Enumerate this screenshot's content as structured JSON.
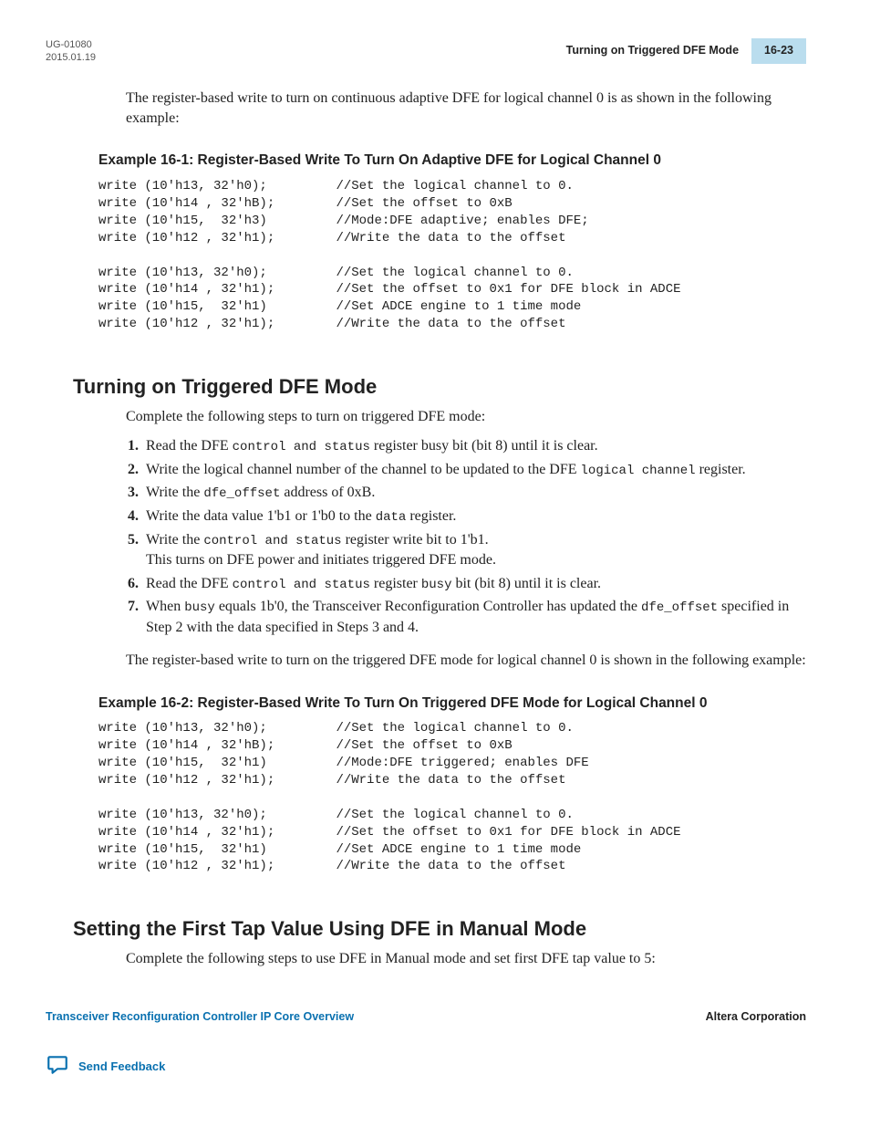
{
  "header": {
    "doc_id": "UG-01080",
    "date": "2015.01.19",
    "running_title": "Turning on Triggered DFE Mode",
    "page_num": "16-23"
  },
  "intro_para": "The register-based write to turn on continuous adaptive DFE for logical channel 0 is as shown in the following example:",
  "example1": {
    "title": "Example 16-1: Register-Based Write To Turn On Adaptive DFE for Logical Channel 0",
    "code": "write (10'h13, 32'h0);         //Set the logical channel to 0.\nwrite (10'h14 , 32'hB);        //Set the offset to 0xB\nwrite (10'h15,  32'h3)         //Mode:DFE adaptive; enables DFE;\nwrite (10'h12 , 32'h1);        //Write the data to the offset\n\nwrite (10'h13, 32'h0);         //Set the logical channel to 0.\nwrite (10'h14 , 32'h1);        //Set the offset to 0x1 for DFE block in ADCE\nwrite (10'h15,  32'h1)         //Set ADCE engine to 1 time mode\nwrite (10'h12 , 32'h1);        //Write the data to the offset"
  },
  "section1": {
    "heading": "Turning on Triggered DFE Mode",
    "intro": "Complete the following steps to turn on triggered DFE mode:",
    "steps": [
      "Read the DFE <span class=\"mono\">control and status</span> register busy bit (bit 8) until it is clear.",
      "Write the logical channel number of the channel to be updated to the DFE <span class=\"mono\">logical channel</span> register.",
      "Write the <span class=\"mono\">dfe_offset</span> address of 0xB.",
      "Write the data value 1'b1 or 1'b0 to the <span class=\"mono\">data</span> register.",
      "Write the <span class=\"mono\">control and status</span> register write bit to 1'b1.<br>This turns on DFE power and initiates triggered DFE mode.",
      "Read the DFE <span class=\"mono\">control and status</span> register <span class=\"mono\">busy</span> bit (bit 8) until it is clear.",
      "When <span class=\"mono\">busy</span> equals 1b'0, the Transceiver Reconfiguration Controller has updated the <span class=\"mono\">dfe_offset</span> specified in Step 2 with the data specified in Steps 3 and 4."
    ],
    "outro": "The register-based write to turn on the triggered DFE mode for logical channel 0 is shown in the following example:"
  },
  "example2": {
    "title": "Example 16-2: Register-Based Write To Turn On Triggered DFE Mode for Logical Channel 0",
    "code": "write (10'h13, 32'h0);         //Set the logical channel to 0.\nwrite (10'h14 , 32'hB);        //Set the offset to 0xB\nwrite (10'h15,  32'h1)         //Mode:DFE triggered; enables DFE\nwrite (10'h12 , 32'h1);        //Write the data to the offset\n\nwrite (10'h13, 32'h0);         //Set the logical channel to 0.\nwrite (10'h14 , 32'h1);        //Set the offset to 0x1 for DFE block in ADCE\nwrite (10'h15,  32'h1)         //Set ADCE engine to 1 time mode\nwrite (10'h12 , 32'h1);        //Write the data to the offset"
  },
  "section2": {
    "heading": "Setting the First Tap Value Using DFE in Manual Mode",
    "intro": "Complete the following steps to use DFE in Manual mode and set first DFE tap value to 5:"
  },
  "footer": {
    "link": "Transceiver Reconfiguration Controller IP Core Overview",
    "corp": "Altera Corporation",
    "feedback": "Send Feedback"
  }
}
